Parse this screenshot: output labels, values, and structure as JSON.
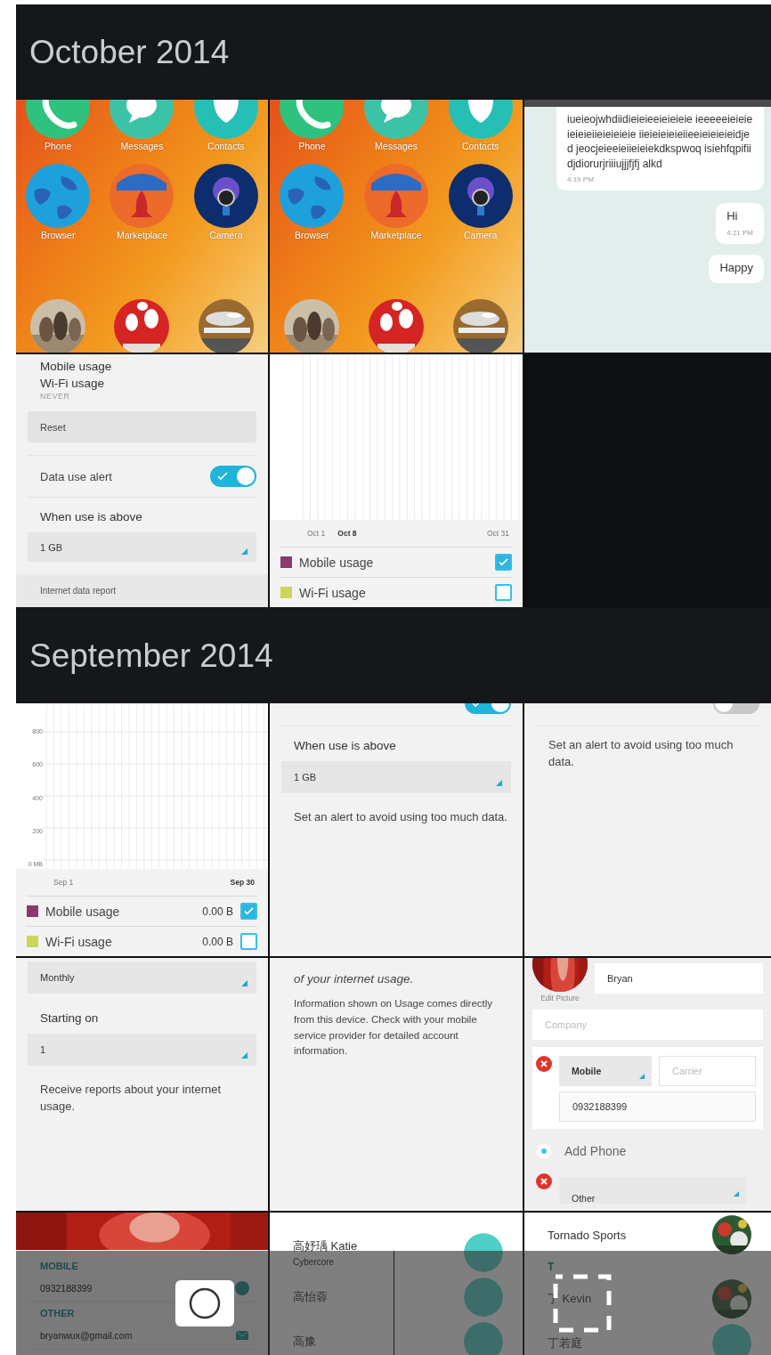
{
  "sections": [
    {
      "title": "October 2014",
      "thumbnails": [
        {
          "kind": "homescreen",
          "apps": [
            {
              "label": "Phone"
            },
            {
              "label": "Messages"
            },
            {
              "label": "Contacts"
            },
            {
              "label": "Browser"
            },
            {
              "label": "Marketplace"
            },
            {
              "label": "Camera"
            }
          ]
        },
        {
          "kind": "homescreen",
          "apps": [
            {
              "label": "Phone"
            },
            {
              "label": "Messages"
            },
            {
              "label": "Contacts"
            },
            {
              "label": "Browser"
            },
            {
              "label": "Marketplace"
            },
            {
              "label": "Camera"
            }
          ]
        },
        {
          "kind": "chat",
          "messages": [
            {
              "text": "iueieojwhdiidieieieeieieieie ieeeeeieieieieieieiieieieieie iieieieieieiieeieieieieidjed jeocjeieeieiieieiekdkspwoq isiehfqpifiidjdiorurjriiiujjjfjfj alkd",
              "time": "4:19 PM",
              "sent": false
            },
            {
              "text": "Hi",
              "time": "4:21 PM",
              "sent": true
            },
            {
              "text": "Happy",
              "sent": true
            }
          ]
        },
        {
          "kind": "settings",
          "rows": [
            {
              "kind": "label",
              "text": "Mobile usage"
            },
            {
              "kind": "label",
              "text": "Wi-Fi usage"
            },
            {
              "kind": "caption",
              "text": "NEVER"
            },
            {
              "kind": "button",
              "text": "Reset"
            },
            {
              "kind": "toggle",
              "text": "Data use alert",
              "on": true
            },
            {
              "kind": "label",
              "text": "When use is above"
            },
            {
              "kind": "select",
              "text": "1 GB"
            },
            {
              "kind": "header",
              "text": "Internet data report"
            }
          ]
        },
        {
          "kind": "usage",
          "dates": [
            {
              "text": "Oct 1",
              "bold": false
            },
            {
              "text": "Oct 8",
              "bold": true
            },
            {
              "text": "Oct 31",
              "bold": false
            }
          ],
          "legend": [
            {
              "label": "Mobile usage",
              "color": "#8b3a6e",
              "checked": true
            },
            {
              "label": "Wi-Fi usage",
              "color": "#cdd65a",
              "checked": false
            }
          ]
        }
      ]
    },
    {
      "title": "September 2014",
      "thumbnails": [
        {
          "kind": "usage",
          "yticks": [
            "800",
            "600",
            "400",
            "200",
            "0 MB"
          ],
          "dates": [
            {
              "text": "Sep 1",
              "bold": false
            },
            {
              "text": "Sep 30",
              "bold": true
            }
          ],
          "legend": [
            {
              "label": "Mobile usage",
              "color": "#8b3a6e",
              "value": "0.00 B",
              "checked": true
            },
            {
              "label": "Wi-Fi usage",
              "color": "#cdd65a",
              "value": "0.00 B",
              "checked": false
            }
          ]
        },
        {
          "kind": "settings",
          "rows": [
            {
              "kind": "toggle",
              "on": true
            },
            {
              "kind": "label",
              "text": "When use is above"
            },
            {
              "kind": "select",
              "text": "1 GB"
            },
            {
              "kind": "note",
              "text": "Set an alert to avoid using too much data."
            }
          ]
        },
        {
          "kind": "settings",
          "rows": [
            {
              "kind": "toggle",
              "on": false
            },
            {
              "kind": "note",
              "text": "Set an alert to avoid using too much data."
            }
          ]
        },
        {
          "kind": "settings",
          "rows": [
            {
              "kind": "select",
              "text": "Monthly"
            },
            {
              "kind": "label",
              "text": "Starting on"
            },
            {
              "kind": "select",
              "text": "1"
            },
            {
              "kind": "note",
              "text": "Receive reports about your internet usage."
            }
          ]
        },
        {
          "kind": "settings",
          "rows": [
            {
              "kind": "lead",
              "text": "of your internet usage."
            },
            {
              "kind": "small",
              "text": "Information shown on Usage comes directly from this device. Check with your mobile service provider for detailed account information."
            }
          ]
        },
        {
          "kind": "contact-form",
          "picture_label": "Edit Picture",
          "name": "Bryan",
          "company_placeholder": "Company",
          "phones": [
            {
              "type": "Mobile",
              "carrier_placeholder": "Carrier",
              "number": "0932188399"
            }
          ],
          "add_label": "Add Phone",
          "other_type": "Other"
        },
        {
          "kind": "contact-detail",
          "groups": [
            {
              "kind": "phone",
              "label": "MOBILE",
              "value": "0932188399"
            },
            {
              "kind": "email",
              "label": "OTHER",
              "value": "bryanwux@gmail.com"
            }
          ]
        },
        {
          "kind": "contact-list",
          "items": [
            {
              "kind": "contact",
              "name": "高妤瑀 Katie",
              "detail": "Cybercore",
              "photo": false
            },
            {
              "kind": "contact",
              "name": "高怡蓉",
              "photo": false
            },
            {
              "kind": "contact",
              "name": "高豫",
              "photo": false
            }
          ]
        },
        {
          "kind": "contact-list",
          "items": [
            {
              "kind": "contact",
              "name": "Tornado Sports",
              "photo": true
            },
            {
              "kind": "header",
              "text": "T"
            },
            {
              "kind": "contact",
              "name": "丁 Kevin",
              "photo": true
            },
            {
              "kind": "contact",
              "name": "丁若庭",
              "photo": false
            }
          ]
        }
      ]
    }
  ],
  "toolbar": {
    "buttons": [
      {
        "kind": "camera"
      },
      {
        "kind": "select"
      }
    ]
  }
}
